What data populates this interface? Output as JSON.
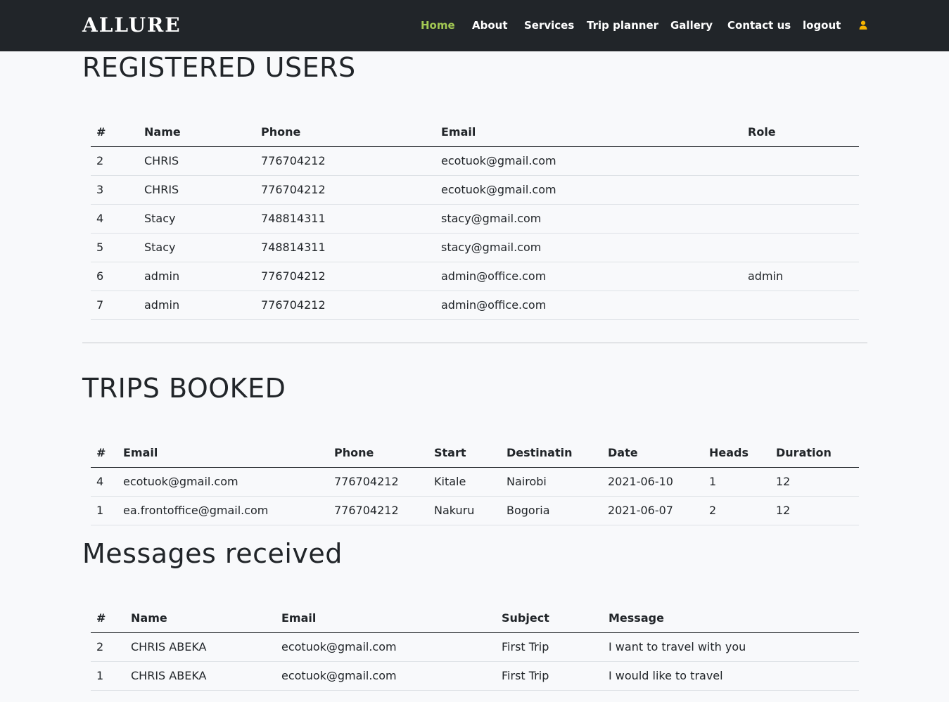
{
  "nav": {
    "brand": "ALLURE",
    "links": [
      {
        "label": "Home",
        "active": true
      },
      {
        "label": "About"
      },
      {
        "label": "Services"
      },
      {
        "label": "Trip planner"
      },
      {
        "label": "Gallery"
      },
      {
        "label": "Contact us"
      },
      {
        "label": "logout"
      }
    ],
    "user_icon": "user-icon",
    "active_color": "#a3c853",
    "icon_color": "#f5b400",
    "bg_color": "#212529"
  },
  "users": {
    "title": "REGISTERED USERS",
    "columns": [
      "#",
      "Name",
      "Phone",
      "Email",
      "Role"
    ],
    "rows": [
      [
        "2",
        "CHRIS",
        "776704212",
        "ecotuok@gmail.com",
        ""
      ],
      [
        "3",
        "CHRIS",
        "776704212",
        "ecotuok@gmail.com",
        ""
      ],
      [
        "4",
        "Stacy",
        "748814311",
        "stacy@gmail.com",
        ""
      ],
      [
        "5",
        "Stacy",
        "748814311",
        "stacy@gmail.com",
        ""
      ],
      [
        "6",
        "admin",
        "776704212",
        "admin@office.com",
        "admin"
      ],
      [
        "7",
        "admin",
        "776704212",
        "admin@office.com",
        ""
      ]
    ]
  },
  "trips": {
    "title": "TRIPS BOOKED",
    "columns": [
      "#",
      "Email",
      "Phone",
      "Start",
      "Destinatin",
      "Date",
      "Heads",
      "Duration"
    ],
    "rows": [
      [
        "4",
        "ecotuok@gmail.com",
        "776704212",
        "Kitale",
        "Nairobi",
        "2021-06-10",
        "1",
        "12"
      ],
      [
        "1",
        "ea.frontoffice@gmail.com",
        "776704212",
        "Nakuru",
        "Bogoria",
        "2021-06-07",
        "2",
        "12"
      ]
    ]
  },
  "messages": {
    "title": "Messages received",
    "columns": [
      "#",
      "Name",
      "Email",
      "Subject",
      "Message"
    ],
    "rows": [
      [
        "2",
        "CHRIS ABEKA",
        "ecotuok@gmail.com",
        "First Trip",
        "I want to travel with you"
      ],
      [
        "1",
        "CHRIS ABEKA",
        "ecotuok@gmail.com",
        "First Trip",
        "I would like to travel"
      ]
    ]
  }
}
